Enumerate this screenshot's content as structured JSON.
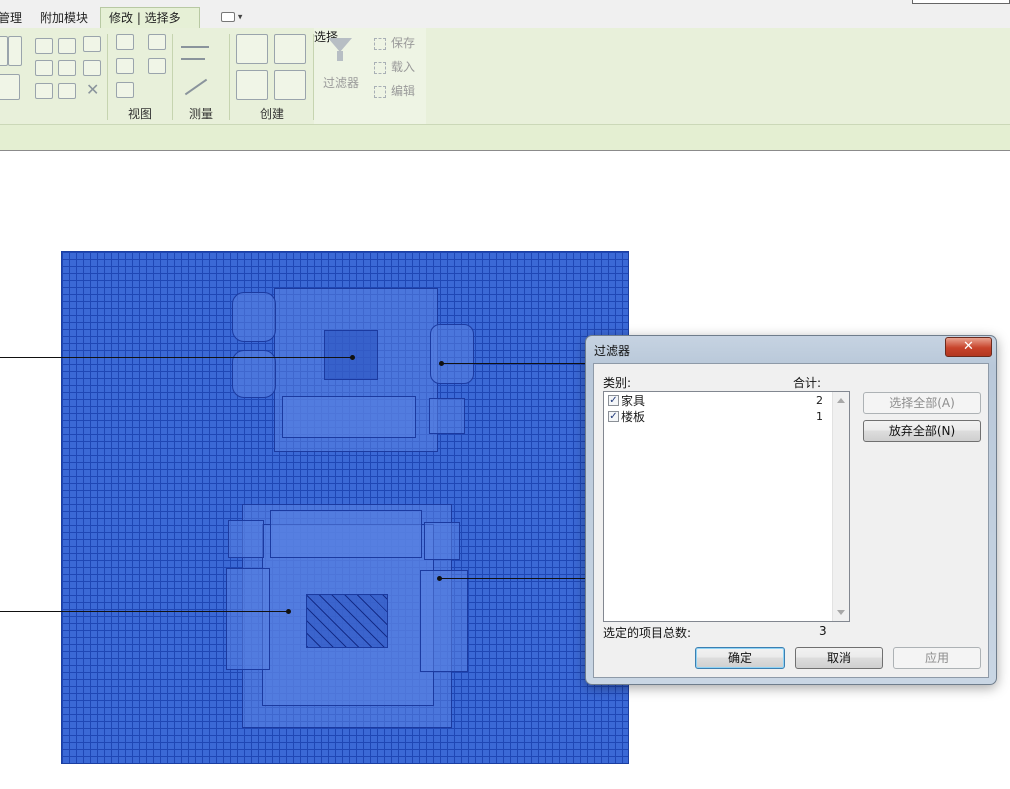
{
  "tabs": [
    {
      "label": "管理"
    },
    {
      "label": "附加模块"
    },
    {
      "label": "修改 | 选择多个"
    }
  ],
  "ribbon": {
    "panels": {
      "view": "视图",
      "measure": "测量",
      "create": "创建",
      "select": "选择"
    },
    "filter_label": "过滤器",
    "save": "保存",
    "load": "载入",
    "edit": "编辑"
  },
  "dialog": {
    "title": "过滤器",
    "close_glyph": "✕",
    "col_category": "类别:",
    "col_total": "合计:",
    "rows": [
      {
        "name": "家具",
        "count": "2",
        "checked": true
      },
      {
        "name": "楼板",
        "count": "1",
        "checked": true
      }
    ],
    "select_all": "选择全部(A)",
    "deselect_all": "放弃全部(N)",
    "total_label": "选定的项目总数:",
    "total_value": "3",
    "ok": "确定",
    "cancel": "取消",
    "apply": "应用"
  },
  "colors": {
    "ribbon_bg": "#e8f0da",
    "selection_blue": "#3b69d6",
    "dialog_frame": "#c6d3e2",
    "close_red": "#c7432b"
  },
  "icons": [
    "funnel-icon",
    "checkmark-icon",
    "close-icon",
    "scroll-up-icon",
    "scroll-down-icon"
  ]
}
